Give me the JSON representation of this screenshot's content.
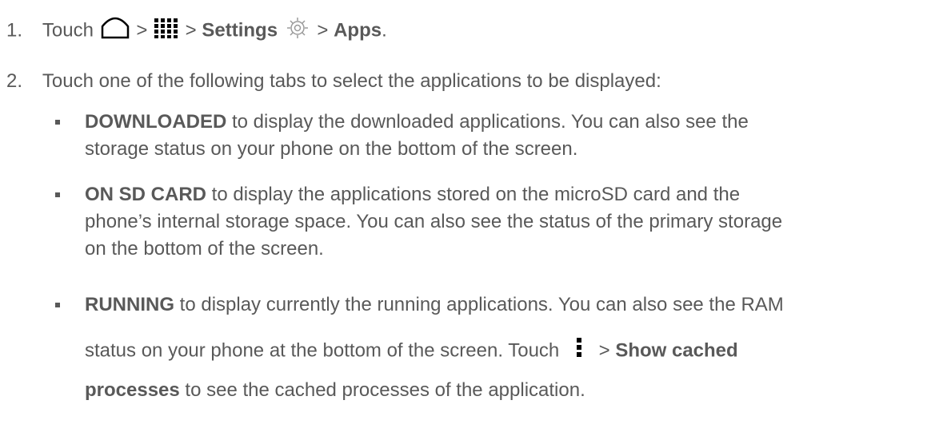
{
  "steps": [
    {
      "number": "1.",
      "parts": {
        "touch": "Touch",
        "sep1": ">",
        "sep2": ">",
        "settings": "Settings",
        "sep3": ">",
        "apps": "Apps",
        "end": "."
      },
      "icons": [
        "home-icon",
        "apps-grid-icon",
        "settings-gear-icon"
      ]
    },
    {
      "number": "2.",
      "text": "Touch one of the following tabs to select the applications to be displayed:"
    }
  ],
  "bullets": [
    {
      "term": "DOWNLOADED",
      "line1": " to display the downloaded applications. You can also see the",
      "line2": "storage status on your phone on the bottom of the screen."
    },
    {
      "term": "ON SD CARD",
      "line1": " to display the applications stored on the microSD card and the",
      "line2": "phone’s internal storage space. You can also see the status of the primary storage",
      "line3": "on the bottom of the screen."
    },
    {
      "term": "RUNNING",
      "line1": " to display currently the running applications. You can also see the RAM",
      "line2_a": "status on your phone at the bottom of the screen. Touch",
      "line2_sep": ">",
      "line2_bold": "Show cached",
      "line3_bold": "processes",
      "line3_rest": " to see the cached processes of the application.",
      "icon": "menu-dots-icon"
    }
  ]
}
